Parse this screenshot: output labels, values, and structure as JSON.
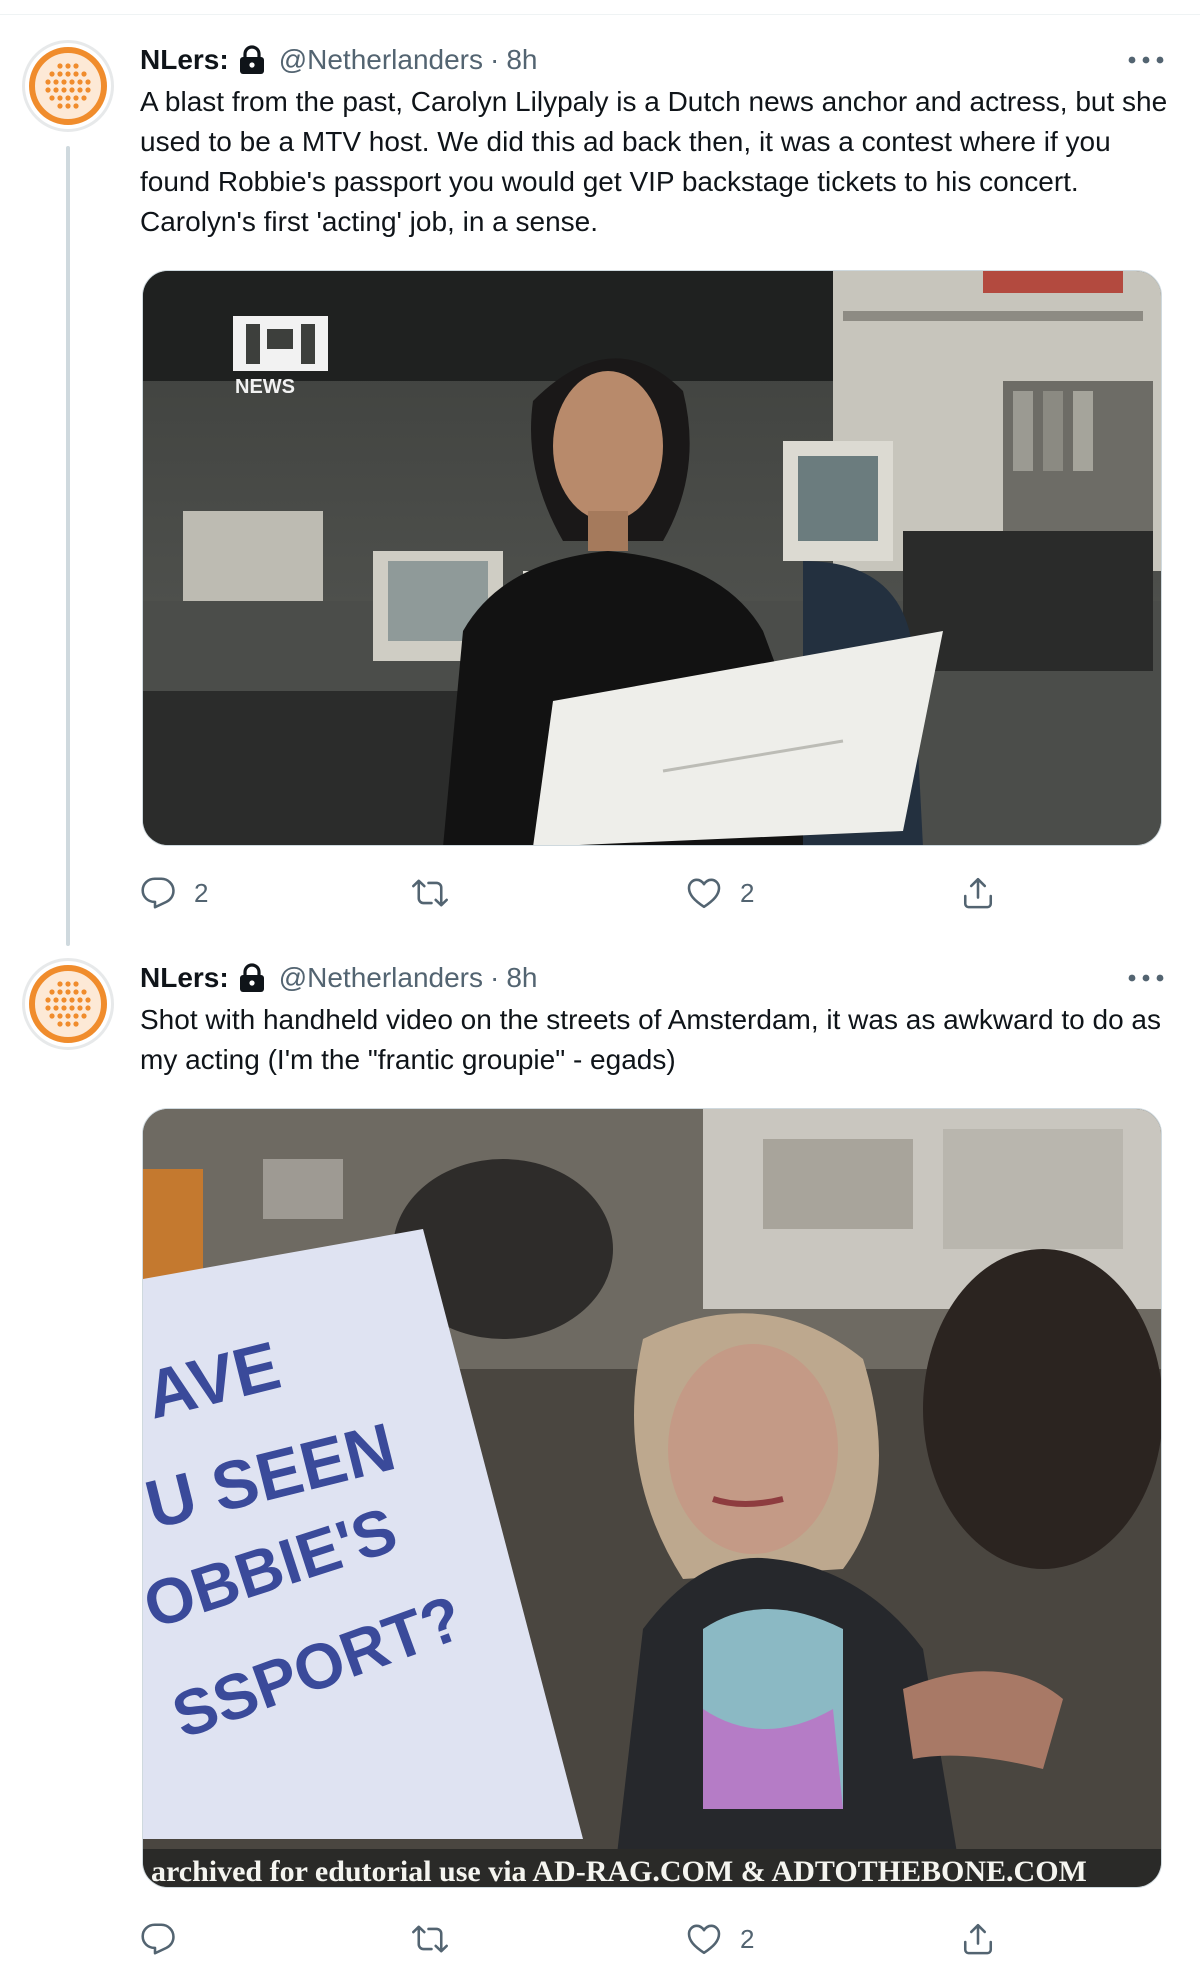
{
  "thread": {
    "tweets": [
      {
        "author": {
          "name": "NLers:",
          "handle": "@Netherlanders",
          "separator": "·",
          "time": "8h"
        },
        "text": "A blast from the past, Carolyn Lilypaly is a Dutch news anchor and actress, but she used to be a MTV host. We did this ad back then, it was a contest where if you found Robbie's passport you would get VIP backstage tickets to his concert. Carolyn's first 'acting' job, in a sense.",
        "media": {
          "logo_text": "NEWS"
        },
        "actions": {
          "replies": "2",
          "retweets": "",
          "likes": "2"
        }
      },
      {
        "author": {
          "name": "NLers:",
          "handle": "@Netherlanders",
          "separator": "·",
          "time": "8h"
        },
        "text": "Shot with handheld video on the streets of Amsterdam, it was as awkward to do as my acting (I'm the \"frantic groupie\" - egads)",
        "media": {
          "sign_lines": [
            "AVE",
            "U SEEN",
            "OBBIE'S",
            "SSPORT?"
          ],
          "caption": "archived for edutorial use via AD-RAG.COM & ADTOTHEBONE.COM"
        },
        "actions": {
          "replies": "",
          "retweets": "",
          "likes": "2"
        }
      }
    ]
  },
  "colors": {
    "text": "#0f1419",
    "secondary": "#536471",
    "avatar_orange": "#f08c2c",
    "thread_line": "#cfd9de"
  },
  "icons": [
    "lock-icon",
    "more-icon",
    "reply-icon",
    "retweet-icon",
    "like-icon",
    "share-icon"
  ]
}
